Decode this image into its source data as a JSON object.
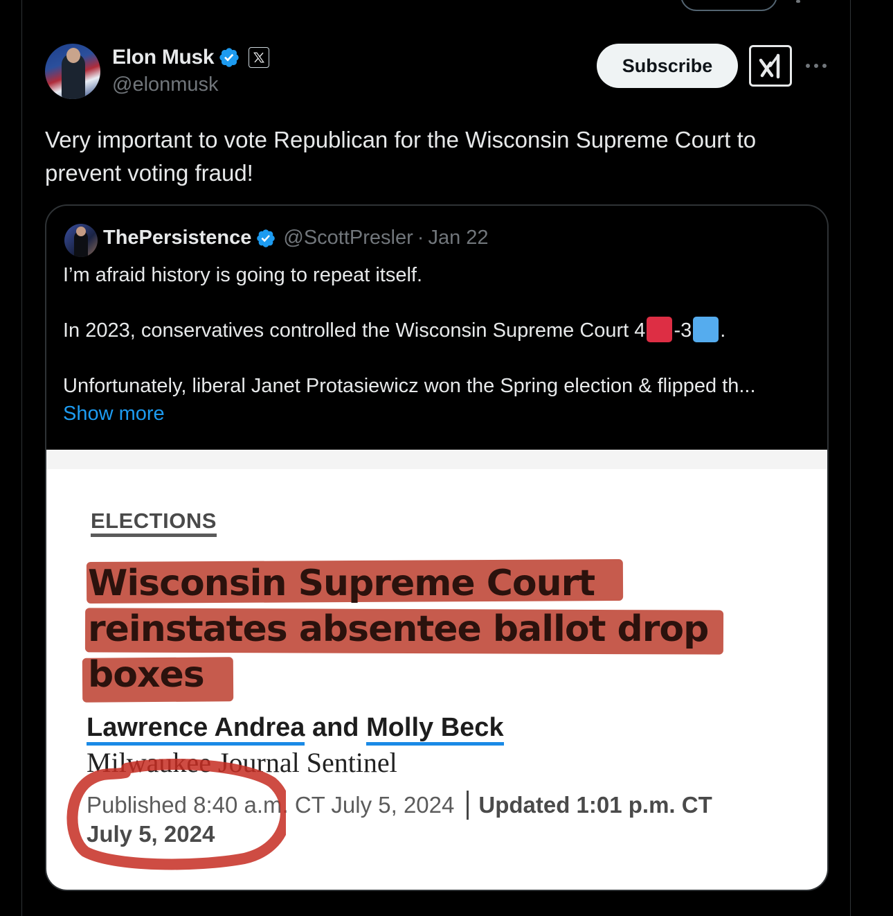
{
  "author": {
    "display_name": "Elon Musk",
    "handle": "@elonmusk",
    "verified": true
  },
  "actions": {
    "subscribe_label": "Subscribe",
    "grok_icon": "grok-icon",
    "more_icon": "more-horizontal-icon"
  },
  "tweet": {
    "text": "Very important to vote Republican for the Wisconsin Supreme Court to prevent voting fraud!"
  },
  "quote": {
    "display_name": "ThePersistence",
    "handle": "@ScottPresler",
    "separator": "·",
    "date": "Jan 22",
    "line1": "I’m afraid history is going to repeat itself.",
    "line2_prefix": "In 2023, conservatives controlled the Wisconsin Supreme Court 4",
    "line2_mid": "-3",
    "line2_suffix": ".",
    "line3": "Unfortunately, liberal Janet Protasiewicz won the Spring election & flipped th...",
    "show_more": "Show more"
  },
  "article": {
    "section": "ELECTIONS",
    "headline_line1": "Wisconsin Supreme Court",
    "headline_line2": "reinstates absentee ballot drop",
    "headline_line3": "boxes",
    "author1": "Lawrence Andrea",
    "and": "and",
    "author2": "Molly Beck",
    "publication": "Milwaukee Journal Sentinel",
    "published": "Published 8:40 a.m. CT July 5, 2024",
    "updated": "Updated 1:01 p.m. CT",
    "updated_date": "July 5, 2024"
  },
  "colors": {
    "background": "#000000",
    "text_primary": "#e7e9ea",
    "text_secondary": "#71767b",
    "verified_blue": "#1d9bf0",
    "link_blue": "#1d9bf0",
    "highlight_red": "#c0493a",
    "flag_red": "#dd2e44",
    "flag_blue": "#55acee"
  }
}
